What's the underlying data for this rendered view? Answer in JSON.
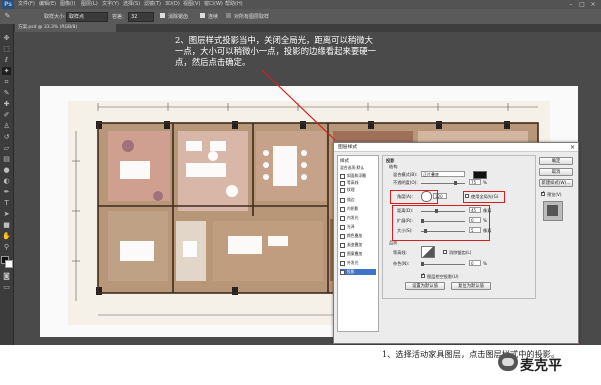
{
  "app": {
    "logo": "Ps",
    "menu": [
      "文件(F)",
      "编辑(E)",
      "图像(I)",
      "图层(L)",
      "文字(Y)",
      "选择(S)",
      "滤镜(T)",
      "3D(D)",
      "视图(V)",
      "窗口(W)",
      "帮助(H)"
    ]
  },
  "options": {
    "sample_size_label": "取样大小:",
    "sample_size_value": "取样点",
    "tolerance_label": "容差:",
    "tolerance_value": "32",
    "antialias_label": "消除锯齿",
    "contiguous_label": "连续",
    "all_layers_label": "对所有图层取样"
  },
  "document_tab": {
    "label": "方案.psd @ 33.3% (RGB/8)"
  },
  "annotations": {
    "top_note": [
      "2、图层样式投影当中，关闭全局光，距离可以稍微大",
      "一点，大小可以稍微小一点，投影的边缘看起来要硬一",
      "点，然后点击确定。"
    ],
    "bottom_note": "1、选择活动家具图层，点击图层样式中的投影。",
    "watermark": "麦克平"
  },
  "dialog": {
    "title": "图层样式",
    "styles_header": "样式",
    "blend_options": "混合选项:默认",
    "styles": [
      {
        "label": "斜面和浮雕",
        "checked": false
      },
      {
        "label": "等高线",
        "checked": false
      },
      {
        "label": "纹理",
        "checked": false
      },
      {
        "label": "描边",
        "checked": false
      },
      {
        "label": "内阴影",
        "checked": false
      },
      {
        "label": "内发光",
        "checked": false
      },
      {
        "label": "光泽",
        "checked": false
      },
      {
        "label": "颜色叠加",
        "checked": false
      },
      {
        "label": "渐变叠加",
        "checked": false
      },
      {
        "label": "图案叠加",
        "checked": false
      },
      {
        "label": "外发光",
        "checked": false
      },
      {
        "label": "投影",
        "checked": true
      }
    ],
    "section_title": "投影",
    "structure_title": "结构",
    "blend_mode_label": "混合模式(B):",
    "blend_mode_value": "正片叠底",
    "opacity_label": "不透明度(O):",
    "opacity_value": "75",
    "angle_label": "角度(A):",
    "angle_value": "120",
    "global_light_label": "使用全局光(G)",
    "distance_label": "距离(D):",
    "distance_value": "45",
    "spread_label": "扩展(R):",
    "spread_value": "0",
    "size_label": "大小(S):",
    "size_value": "5",
    "unit_px": "像素",
    "unit_pct": "%",
    "quality_title": "品质",
    "contour_label": "等高线:",
    "antialias_label": "消除锯齿(L)",
    "noise_label": "杂色(N):",
    "noise_value": "0",
    "knockout_label": "图层挖空投影(U)",
    "set_default": "设置为默认值",
    "reset_default": "复位为默认值",
    "ok": "确定",
    "cancel": "取消",
    "new_style": "新建样式(W)...",
    "preview": "预览(V)",
    "shadow_color": "#111111"
  }
}
